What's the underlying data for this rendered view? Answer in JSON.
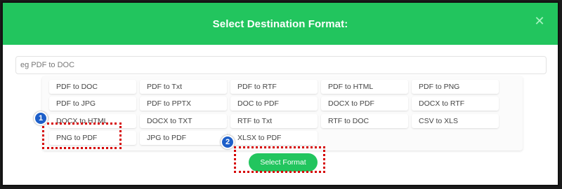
{
  "dialog": {
    "title": "Select Destination Format:",
    "close_icon": "close-icon",
    "accent_color": "#22c55e"
  },
  "search": {
    "placeholder": "eg PDF to DOC",
    "value": ""
  },
  "options": [
    "PDF to DOC",
    "PDF to Txt",
    "PDF to RTF",
    "PDF to HTML",
    "PDF to PNG",
    "PDF to JPG",
    "PDF to PPTX",
    "DOC to PDF",
    "DOCX to PDF",
    "DOCX to RTF",
    "DOCX to HTML",
    "DOCX to TXT",
    "RTF to Txt",
    "RTF to DOC",
    "CSV to XLS",
    "PNG to PDF",
    "JPG to PDF",
    "XLSX to PDF"
  ],
  "annotations": {
    "step1": "1",
    "step2": "2",
    "highlight_color": "#d60000",
    "badge_color": "#1d5fc9"
  },
  "select_button": {
    "label": "Select Format"
  }
}
